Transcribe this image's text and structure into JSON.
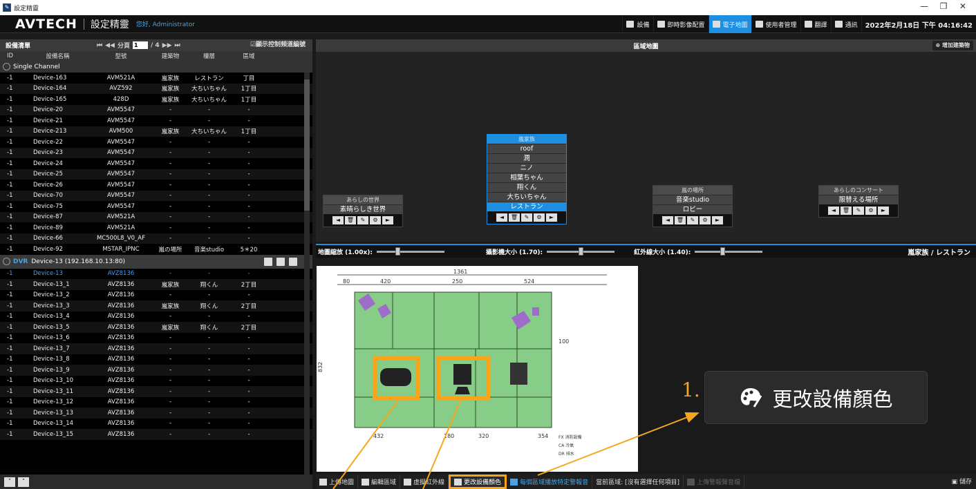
{
  "window": {
    "title": "設定精靈",
    "minimize": "—",
    "restore": "❐",
    "close": "✕"
  },
  "header": {
    "logo": "AVTECH",
    "app_title": "設定精靈",
    "greeting": "您好, Administrator",
    "nav": [
      {
        "label": "設備",
        "active": false
      },
      {
        "label": "即時影像配置",
        "active": false
      },
      {
        "label": "電子地圖",
        "active": true
      },
      {
        "label": "使用者管理",
        "active": false
      },
      {
        "label": "翻譯",
        "active": false
      },
      {
        "label": "通訊",
        "active": false
      }
    ],
    "datetime": "2022年2月18日 下午 04:16:42"
  },
  "device_list": {
    "title": "設備清單",
    "pager": {
      "first": "⏮",
      "prev": "◀◀",
      "label": "分頁",
      "page": "1",
      "total": "/ 4",
      "next": "▶▶",
      "last": "⏭"
    },
    "show_channel": "☑顯示控制頻道編號",
    "columns": [
      "ID",
      "設備名稱",
      "型號",
      "建築物",
      "樓層",
      "區域"
    ],
    "group_single": "Single Channel",
    "single_rows": [
      [
        "-1",
        "Device-163",
        "AVM521A",
        "嵐家族",
        "レストラン",
        "丁目"
      ],
      [
        "-1",
        "Device-164",
        "AVZ592",
        "嵐家族",
        "大ちいちゃん",
        "1丁目"
      ],
      [
        "-1",
        "Device-165",
        "428D",
        "嵐家族",
        "大ちいちゃん",
        "1丁目"
      ],
      [
        "-1",
        "Device-20",
        "AVM5547",
        "-",
        "-",
        "-"
      ],
      [
        "-1",
        "Device-21",
        "AVM5547",
        "-",
        "-",
        "-"
      ],
      [
        "-1",
        "Device-213",
        "AVM500",
        "嵐家族",
        "大ちいちゃん",
        "1丁目"
      ],
      [
        "-1",
        "Device-22",
        "AVM5547",
        "-",
        "-",
        "-"
      ],
      [
        "-1",
        "Device-23",
        "AVM5547",
        "-",
        "-",
        "-"
      ],
      [
        "-1",
        "Device-24",
        "AVM5547",
        "-",
        "-",
        "-"
      ],
      [
        "-1",
        "Device-25",
        "AVM5547",
        "-",
        "-",
        "-"
      ],
      [
        "-1",
        "Device-26",
        "AVM5547",
        "-",
        "-",
        "-"
      ],
      [
        "-1",
        "Device-70",
        "AVM5547",
        "-",
        "-",
        "-"
      ],
      [
        "-1",
        "Device-75",
        "AVM5547",
        "-",
        "-",
        "-"
      ],
      [
        "-1",
        "Device-87",
        "AVM521A",
        "-",
        "-",
        "-"
      ],
      [
        "-1",
        "Device-89",
        "AVM521A",
        "-",
        "-",
        "-"
      ],
      [
        "-1",
        "Device-66",
        "MC500L8_V0_AF",
        "-",
        "-",
        "-"
      ],
      [
        "-1",
        "Device-92",
        "MSTAR_IPNC",
        "嵐の場所",
        "音楽studio",
        "5＊20"
      ]
    ],
    "dvr": {
      "tag": "DVR",
      "label": "Device-13  (192.168.10.13:80)"
    },
    "dvr_rows": [
      [
        "-1",
        "Device-13",
        "AVZ8136",
        "-",
        "-",
        "-"
      ],
      [
        "-1",
        "Device-13_1",
        "AVZ8136",
        "嵐家族",
        "翔くん",
        "2丁目"
      ],
      [
        "-1",
        "Device-13_2",
        "AVZ8136",
        "-",
        "-",
        "-"
      ],
      [
        "-1",
        "Device-13_3",
        "AVZ8136",
        "嵐家族",
        "翔くん",
        "2丁目"
      ],
      [
        "-1",
        "Device-13_4",
        "AVZ8136",
        "-",
        "-",
        "-"
      ],
      [
        "-1",
        "Device-13_5",
        "AVZ8136",
        "嵐家族",
        "翔くん",
        "2丁目"
      ],
      [
        "-1",
        "Device-13_6",
        "AVZ8136",
        "-",
        "-",
        "-"
      ],
      [
        "-1",
        "Device-13_7",
        "AVZ8136",
        "-",
        "-",
        "-"
      ],
      [
        "-1",
        "Device-13_8",
        "AVZ8136",
        "-",
        "-",
        "-"
      ],
      [
        "-1",
        "Device-13_9",
        "AVZ8136",
        "-",
        "-",
        "-"
      ],
      [
        "-1",
        "Device-13_10",
        "AVZ8136",
        "-",
        "-",
        "-"
      ],
      [
        "-1",
        "Device-13_11",
        "AVZ8136",
        "-",
        "-",
        "-"
      ],
      [
        "-1",
        "Device-13_12",
        "AVZ8136",
        "-",
        "-",
        "-"
      ],
      [
        "-1",
        "Device-13_13",
        "AVZ8136",
        "-",
        "-",
        "-"
      ],
      [
        "-1",
        "Device-13_14",
        "AVZ8136",
        "-",
        "-",
        "-"
      ],
      [
        "-1",
        "Device-13_15",
        "AVZ8136",
        "-",
        "-",
        "-"
      ]
    ]
  },
  "area_map": {
    "title": "區域地圖",
    "add_building": "增加建築物",
    "buildings": [
      {
        "name": "あらしの世界",
        "floors": [
          "素晴らしき世界"
        ],
        "current": -1,
        "selected": false
      },
      {
        "name": "嵐家族",
        "floors": [
          "roof",
          "潤",
          "ニノ",
          "相葉ちゃん",
          "翔くん",
          "大ちいちゃん",
          "レストラン"
        ],
        "current": 6,
        "selected": true
      },
      {
        "name": "嵐の場所",
        "floors": [
          "音楽studio",
          "ロビー"
        ],
        "current": -1,
        "selected": false
      },
      {
        "name": "あらしのコンサート",
        "floors": [
          "服替える場所"
        ],
        "current": -1,
        "selected": false
      }
    ],
    "controls": [
      "◄",
      "🗑",
      "✎",
      "⚙",
      "►"
    ]
  },
  "sliders": [
    {
      "label": "地圖縮放 (1.00x):",
      "value": 0.3
    },
    {
      "label": "攝影機大小 (1.70):",
      "value": 0.5
    },
    {
      "label": "紅外線大小 (1.40):",
      "value": 0.4
    }
  ],
  "current_location": "嵐家族 / レストラン",
  "floorplan": {
    "dims": [
      "1361",
      "80",
      "420",
      "250",
      "524",
      "432",
      "180",
      "320",
      "354",
      "100",
      "832"
    ]
  },
  "toolbar": {
    "upload_map": "上傳地圖",
    "edit_area": "編輯區域",
    "virtual_ir": "虛擬紅外線",
    "change_color": "更改設備顏色",
    "alarm_sound": "每個區域播放特定警報音",
    "current_area": "當前區域: [沒有選擇任何項目]",
    "upload_alarm": "上傳警報聲音檔",
    "save": "儲存"
  },
  "annotation": {
    "number": "1.",
    "callout": "更改設備顏色",
    "accent": "#f7a61c"
  }
}
